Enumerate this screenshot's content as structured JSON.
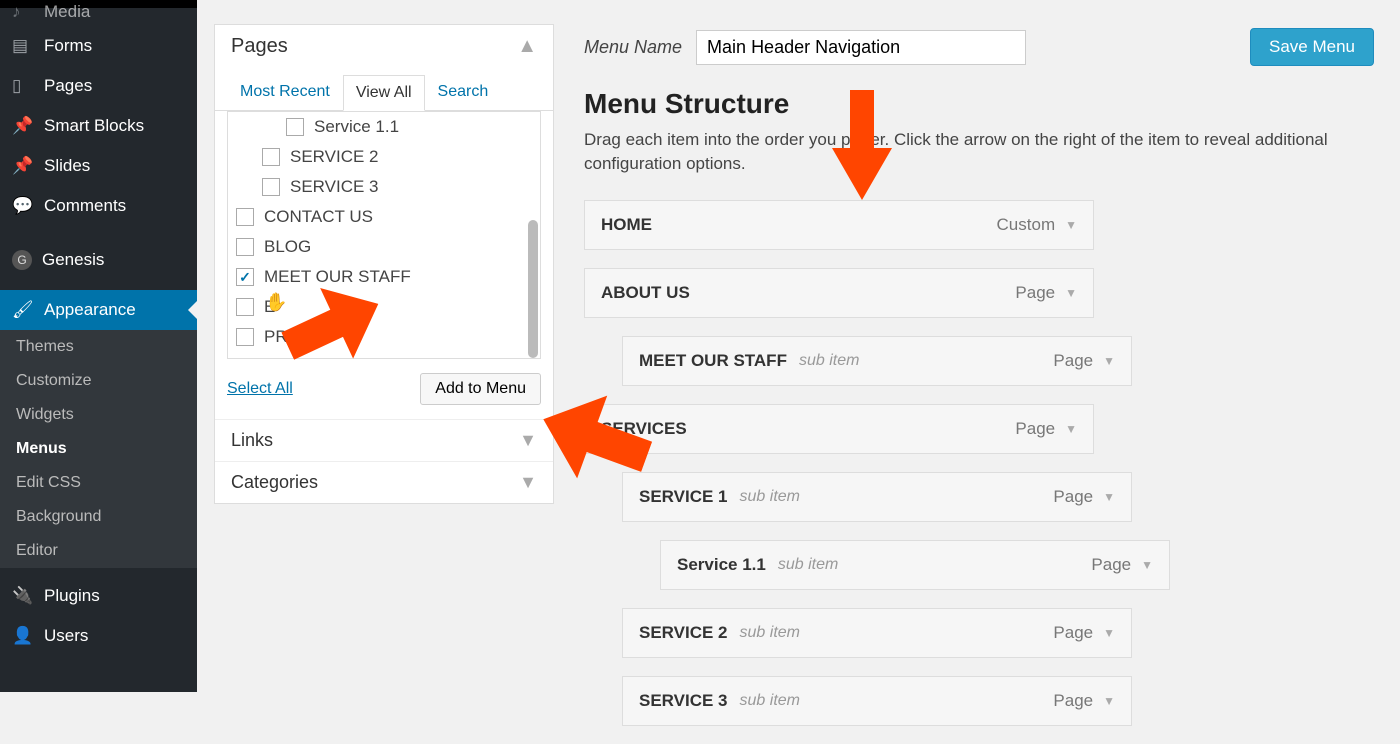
{
  "sidebar": {
    "items": [
      {
        "label": "Media",
        "icon": "media-icon"
      },
      {
        "label": "Forms",
        "icon": "forms-icon"
      },
      {
        "label": "Pages",
        "icon": "pages-icon"
      },
      {
        "label": "Smart Blocks",
        "icon": "pin-icon"
      },
      {
        "label": "Slides",
        "icon": "pin-icon"
      },
      {
        "label": "Comments",
        "icon": "comment-icon"
      }
    ],
    "genesis": {
      "label": "Genesis",
      "icon": "g-icon"
    },
    "appearance": {
      "label": "Appearance",
      "icon": "brush-icon"
    },
    "sub": [
      {
        "label": "Themes"
      },
      {
        "label": "Customize"
      },
      {
        "label": "Widgets"
      },
      {
        "label": "Menus"
      },
      {
        "label": "Edit CSS"
      },
      {
        "label": "Background"
      },
      {
        "label": "Editor"
      }
    ],
    "plugins": {
      "label": "Plugins",
      "icon": "plug-icon"
    },
    "users": {
      "label": "Users",
      "icon": "user-icon"
    }
  },
  "pages_panel": {
    "title": "Pages",
    "tabs": [
      "Most Recent",
      "View All",
      "Search"
    ],
    "items": [
      {
        "label": "Service 1.1",
        "indent": 2,
        "checked": false
      },
      {
        "label": "SERVICE 2",
        "indent": 1,
        "checked": false
      },
      {
        "label": "SERVICE 3",
        "indent": 1,
        "checked": false
      },
      {
        "label": "CONTACT US",
        "indent": 0,
        "checked": false
      },
      {
        "label": "BLOG",
        "indent": 0,
        "checked": false
      },
      {
        "label": "MEET OUR STAFF",
        "indent": 0,
        "checked": true
      },
      {
        "label": "E",
        "indent": 0,
        "checked": false
      },
      {
        "label": "PRODU",
        "indent": 0,
        "checked": false
      }
    ],
    "select_all": "Select All",
    "add_to_menu": "Add to Menu"
  },
  "accordions": [
    {
      "title": "Links"
    },
    {
      "title": "Categories"
    }
  ],
  "menu": {
    "name_label": "Menu Name",
    "name_value": "Main Header Navigation",
    "save": "Save Menu",
    "structure_title": "Menu Structure",
    "structure_desc": "Drag each item into the order you prefer. Click the arrow on the right of the item to reveal additional configuration options.",
    "items": [
      {
        "title": "HOME",
        "type": "Custom",
        "depth": 0,
        "sub": false
      },
      {
        "title": "ABOUT US",
        "type": "Page",
        "depth": 0,
        "sub": false
      },
      {
        "title": "MEET OUR STAFF",
        "type": "Page",
        "depth": 1,
        "sub": true
      },
      {
        "title": "SERVICES",
        "type": "Page",
        "depth": 0,
        "sub": false
      },
      {
        "title": "SERVICE 1",
        "type": "Page",
        "depth": 1,
        "sub": true
      },
      {
        "title": "Service 1.1",
        "type": "Page",
        "depth": 2,
        "sub": true
      },
      {
        "title": "SERVICE 2",
        "type": "Page",
        "depth": 1,
        "sub": true
      },
      {
        "title": "SERVICE 3",
        "type": "Page",
        "depth": 1,
        "sub": true
      }
    ],
    "sub_label": "sub item"
  }
}
